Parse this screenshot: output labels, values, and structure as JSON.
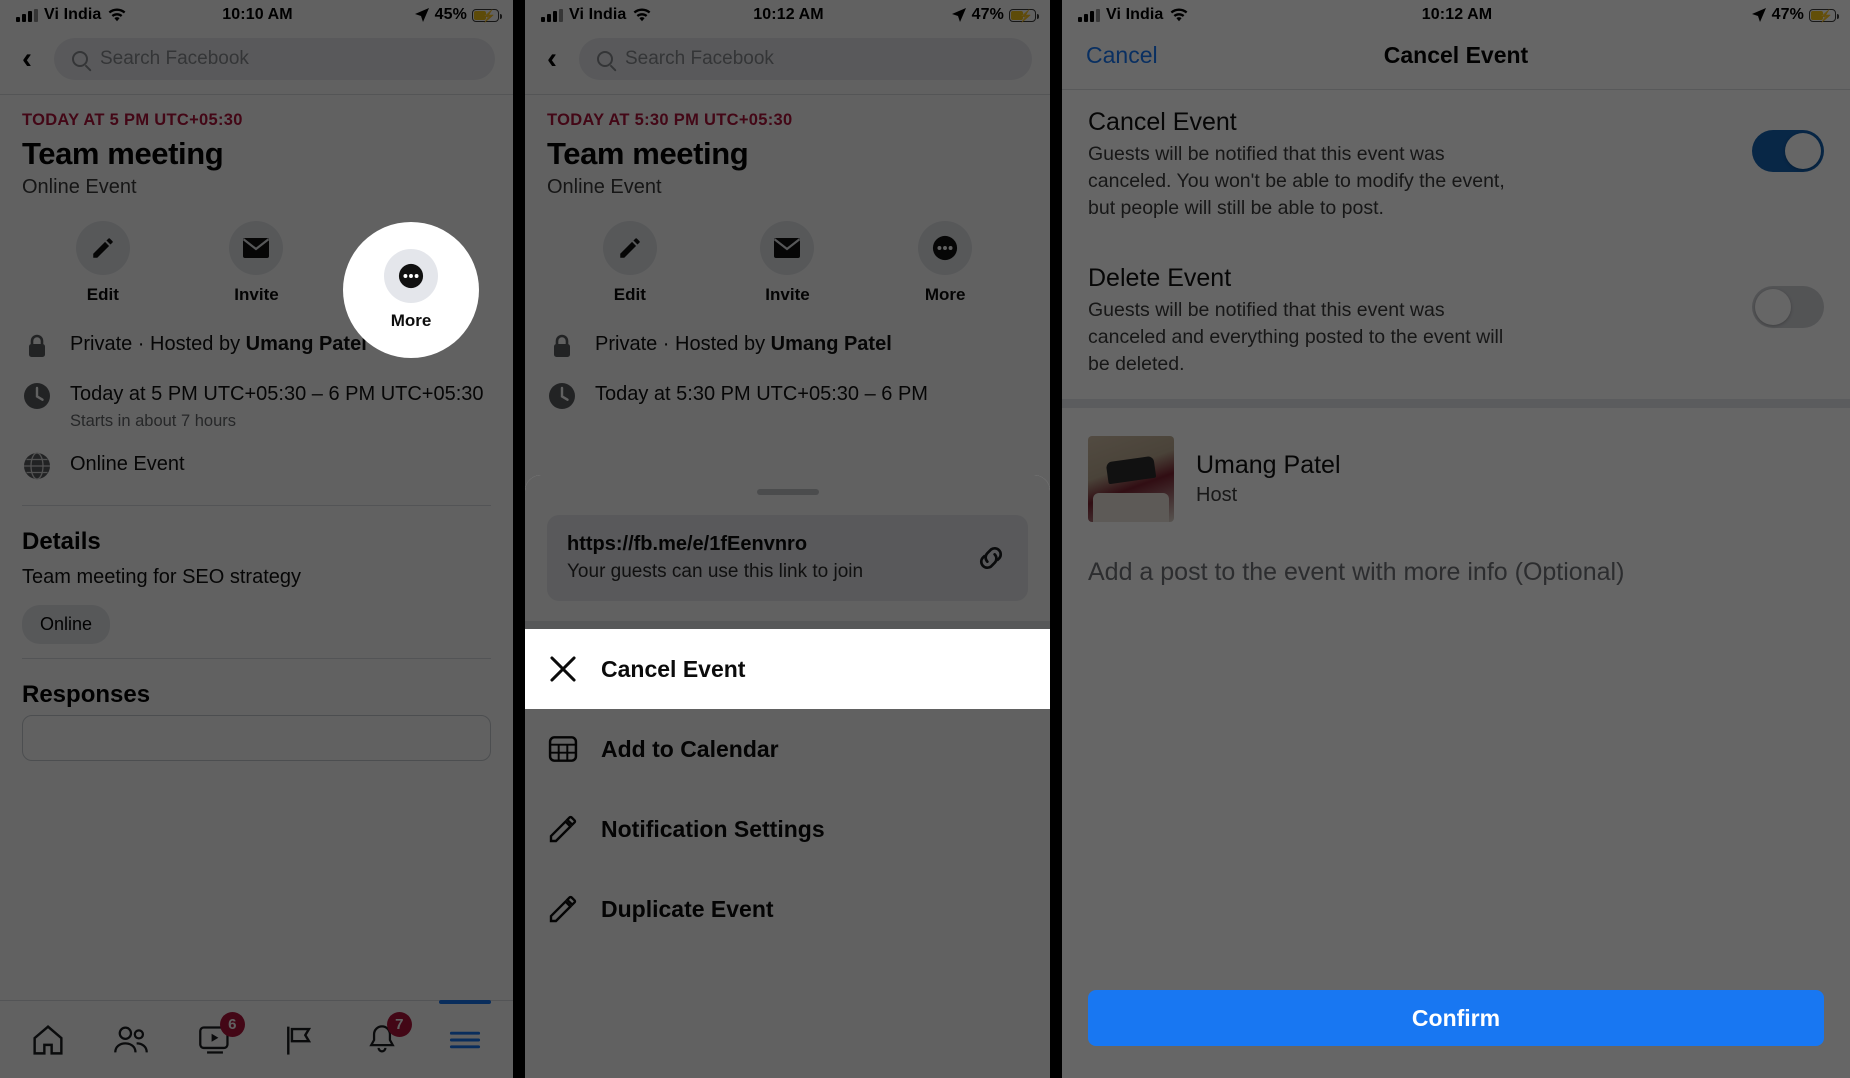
{
  "panel1": {
    "status": {
      "carrier": "Vi India",
      "time": "10:10 AM",
      "battery_pct": "45%",
      "signal_icon": "signal-bars-icon",
      "wifi_icon": "wifi-icon",
      "location_icon": "location-arrow-icon",
      "battery_icon": "battery-charging-icon"
    },
    "search": {
      "placeholder": "Search Facebook",
      "back_icon": "back-chevron-icon",
      "search_icon": "search-icon"
    },
    "event": {
      "date_banner": "TODAY AT 5 PM UTC+05:30",
      "title": "Team meeting",
      "subtitle": "Online Event"
    },
    "actions": [
      {
        "label": "Edit",
        "icon": "pencil-icon"
      },
      {
        "label": "Invite",
        "icon": "envelope-icon"
      },
      {
        "label": "More",
        "icon": "ellipsis-icon"
      }
    ],
    "meta": {
      "privacy_icon": "lock-icon",
      "privacy_prefix": "Private · Hosted by ",
      "privacy_host": "Umang Patel",
      "time_icon": "clock-icon",
      "time_text": "Today at 5 PM UTC+05:30 – 6 PM UTC+05:30",
      "time_sub": "Starts in about 7 hours",
      "location_icon": "globe-icon",
      "location_text": "Online Event"
    },
    "details": {
      "heading": "Details",
      "body": "Team meeting for SEO strategy",
      "tag": "Online"
    },
    "responses": {
      "heading": "Responses"
    },
    "tabbar": [
      {
        "name": "home",
        "icon": "home-icon",
        "badge": ""
      },
      {
        "name": "friends",
        "icon": "friends-icon",
        "badge": ""
      },
      {
        "name": "watch",
        "icon": "watch-icon",
        "badge": "6"
      },
      {
        "name": "marketplace",
        "icon": "marketplace-flag-icon",
        "badge": ""
      },
      {
        "name": "notifications",
        "icon": "bell-icon",
        "badge": "7"
      },
      {
        "name": "menu",
        "icon": "hamburger-menu-icon",
        "badge": ""
      }
    ]
  },
  "panel2": {
    "status": {
      "carrier": "Vi India",
      "time": "10:12 AM",
      "battery_pct": "47%"
    },
    "search": {
      "placeholder": "Search Facebook"
    },
    "event": {
      "date_banner": "TODAY AT 5:30 PM UTC+05:30",
      "title": "Team meeting",
      "subtitle": "Online Event"
    },
    "actions": [
      {
        "label": "Edit",
        "icon": "pencil-icon"
      },
      {
        "label": "Invite",
        "icon": "envelope-icon"
      },
      {
        "label": "More",
        "icon": "ellipsis-icon"
      }
    ],
    "meta": {
      "privacy_prefix": "Private · Hosted by ",
      "privacy_host": "Umang Patel",
      "time_text": "Today at 5:30 PM UTC+05:30 – 6 PM"
    },
    "sheet": {
      "link_url": "https://fb.me/e/1fEenvnro",
      "link_sub": "Your guests can use this link to join",
      "link_icon": "chain-link-icon",
      "items": [
        {
          "label": "Cancel Event",
          "icon": "close-x-icon",
          "highlighted": true
        },
        {
          "label": "Add to Calendar",
          "icon": "calendar-icon",
          "highlighted": false
        },
        {
          "label": "Notification Settings",
          "icon": "pencil-icon",
          "highlighted": false
        },
        {
          "label": "Duplicate Event",
          "icon": "pencil-icon",
          "highlighted": false
        }
      ]
    }
  },
  "panel3": {
    "status": {
      "carrier": "Vi India",
      "time": "10:12 AM",
      "battery_pct": "47%"
    },
    "navbar": {
      "cancel": "Cancel",
      "title": "Cancel Event"
    },
    "options": [
      {
        "title": "Cancel Event",
        "desc": "Guests will be notified that this event was canceled. You won't be able to modify the event, but people will still be able to post.",
        "toggle_on": true
      },
      {
        "title": "Delete Event",
        "desc": "Guests will be notified that this event was canceled and everything posted to the event will be deleted.",
        "toggle_on": false
      }
    ],
    "host": {
      "name": "Umang Patel",
      "role": "Host",
      "avatar_icon": "user-avatar-photo"
    },
    "post_placeholder": "Add a post to the event with more info (Optional)",
    "confirm_label": "Confirm"
  },
  "colors": {
    "facebook_blue": "#1877f2",
    "event_red": "#b0143c",
    "toggle_on": "#1461b0",
    "badge_red": "#b0143c"
  }
}
